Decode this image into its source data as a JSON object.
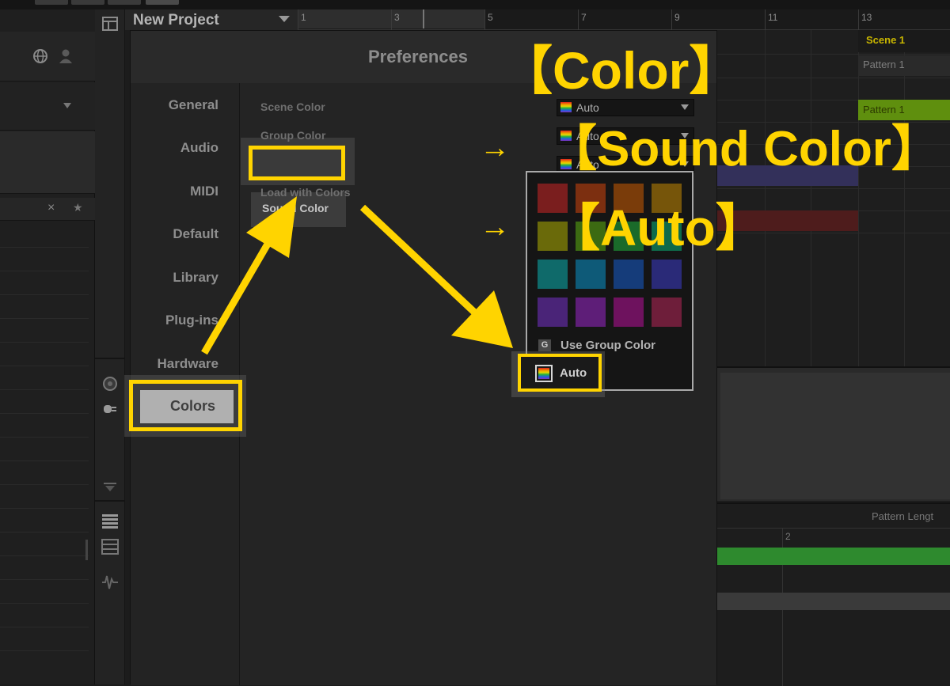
{
  "app": {
    "project_title": "New Project"
  },
  "timeline": {
    "bars": [
      "1",
      "3",
      "5",
      "7",
      "9",
      "11",
      "13"
    ]
  },
  "arranger": {
    "scene_label": "Scene 1",
    "pattern_header": "Pattern 1",
    "pattern_clip": "Pattern 1",
    "pattern_length_label": "Pattern Lengt",
    "bar_number": "2"
  },
  "preferences": {
    "title": "Preferences",
    "categories": [
      "General",
      "Audio",
      "MIDI",
      "Default",
      "Library",
      "Plug-ins",
      "Hardware"
    ],
    "active_category": "Colors",
    "settings": {
      "scene_color_label": "Scene Color",
      "group_color_label": "Group Color",
      "sound_color_label": "Sound Color",
      "load_with_colors_label": "Load with Colors",
      "scene_color_value": "Auto",
      "group_color_value": "Auto",
      "sound_color_value": "Auto"
    }
  },
  "color_popup": {
    "swatches": [
      "#7a1e1e",
      "#7c2f10",
      "#7a3c0a",
      "#76550a",
      "#6a6a0a",
      "#3c6a12",
      "#1a6a2a",
      "#0e6a4a",
      "#0f6a6a",
      "#0e5a78",
      "#153c7a",
      "#2a2a78",
      "#4a2478",
      "#5e1e78",
      "#6e125e",
      "#6e1e3a"
    ],
    "group_letter": "G",
    "use_group_color_label": "Use Group Color",
    "auto_label": "Auto"
  },
  "annotations": {
    "color_note": "【Color】",
    "sound_color_note": "【Sound Color】",
    "auto_note": "【Auto】",
    "accent_color": "#ffd400"
  }
}
